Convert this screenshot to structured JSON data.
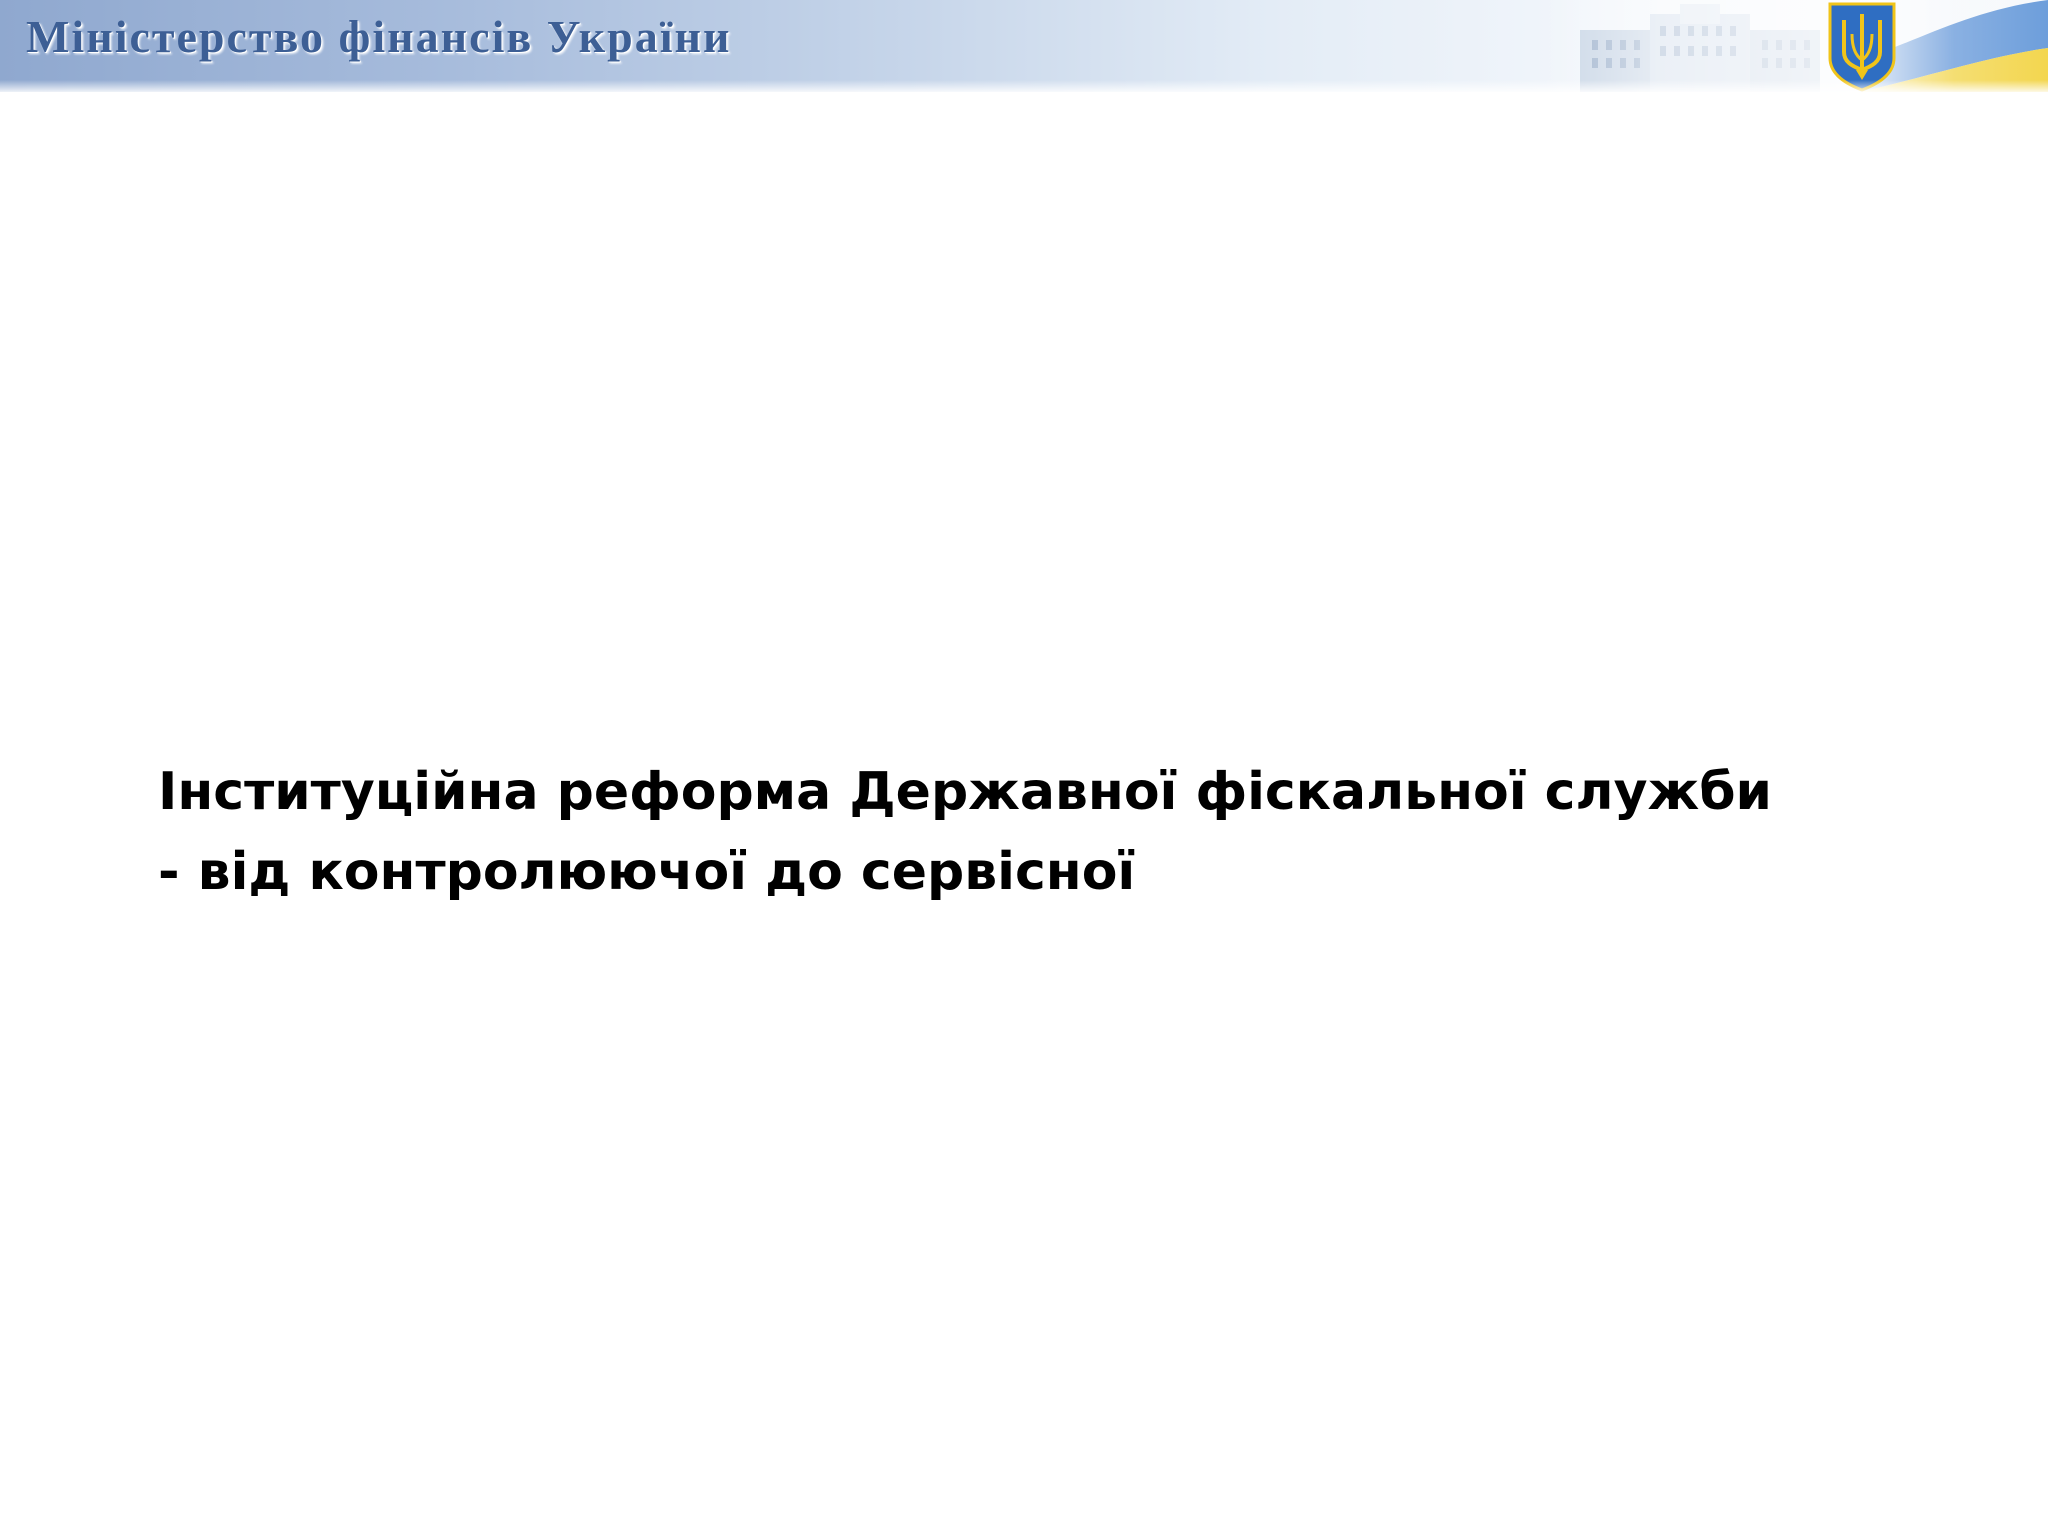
{
  "header": {
    "ministry_name": "Міністерство фінансів України",
    "emblem": "trident-icon",
    "colors": {
      "band_start": "#8fa8cf",
      "title": "#3d5f95",
      "flag_blue": "#3f7fd0",
      "flag_yellow": "#f2d23c",
      "emblem_gold": "#f0c419"
    }
  },
  "slide": {
    "title_line1": "Інституційна реформа Державної фіскальної служби",
    "title_line2": "- від контролюючої до сервісної"
  }
}
